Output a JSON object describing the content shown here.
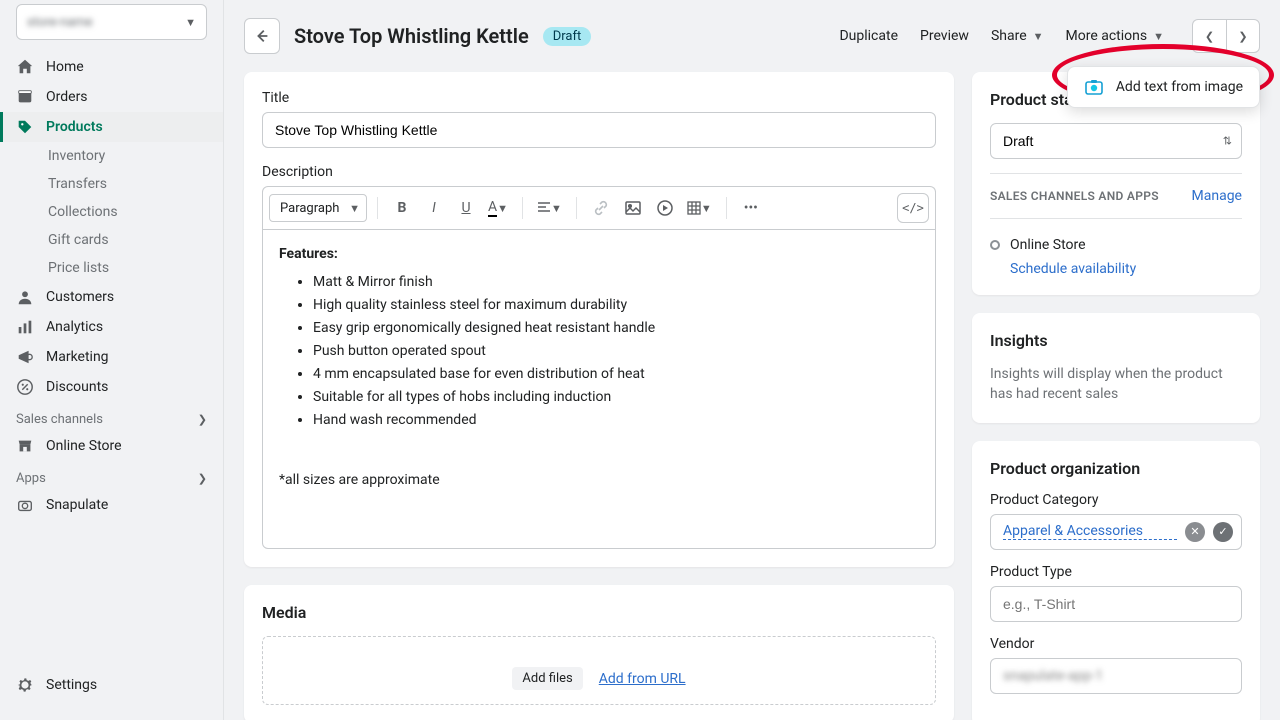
{
  "store_selector": {
    "name": "store-name"
  },
  "sidebar": {
    "items": [
      {
        "label": "Home"
      },
      {
        "label": "Orders"
      },
      {
        "label": "Products"
      },
      {
        "label": "Customers"
      },
      {
        "label": "Analytics"
      },
      {
        "label": "Marketing"
      },
      {
        "label": "Discounts"
      }
    ],
    "products_sub": [
      {
        "label": "Inventory"
      },
      {
        "label": "Transfers"
      },
      {
        "label": "Collections"
      },
      {
        "label": "Gift cards"
      },
      {
        "label": "Price lists"
      }
    ],
    "sales_channels_label": "Sales channels",
    "online_store_label": "Online Store",
    "apps_label": "Apps",
    "app_item_label": "Snapulate",
    "settings_label": "Settings"
  },
  "page": {
    "title": "Stove Top Whistling Kettle",
    "status_badge": "Draft",
    "actions": {
      "duplicate": "Duplicate",
      "preview": "Preview",
      "share": "Share",
      "more": "More actions"
    }
  },
  "popover": {
    "label": "Add text from image"
  },
  "main_card": {
    "title_label": "Title",
    "title_value": "Stove Top Whistling Kettle",
    "description_label": "Description",
    "paragraph_select": "Paragraph",
    "body": {
      "features_heading": "Features:",
      "bullets": [
        "Matt & Mirror finish",
        "High quality stainless steel for maximum durability",
        "Easy grip ergonomically designed heat resistant handle",
        "Push button operated spout",
        "4 mm encapsulated base for even distribution of heat",
        "Suitable for all types of hobs including induction",
        "Hand wash recommended"
      ],
      "footnote": "*all sizes are approximate"
    }
  },
  "media": {
    "title": "Media",
    "add_files": "Add files",
    "add_from_url": "Add from URL"
  },
  "status_card": {
    "title": "Product status",
    "value": "Draft",
    "channels_label": "SALES CHANNELS AND APPS",
    "manage": "Manage",
    "online_store": "Online Store",
    "schedule": "Schedule availability"
  },
  "insights": {
    "title": "Insights",
    "text": "Insights will display when the product has had recent sales"
  },
  "organization": {
    "title": "Product organization",
    "category_label": "Product Category",
    "category_value": "Apparel & Accessories",
    "type_label": "Product Type",
    "type_placeholder": "e.g., T-Shirt",
    "vendor_label": "Vendor",
    "vendor_value": "snapulate-app-1"
  }
}
